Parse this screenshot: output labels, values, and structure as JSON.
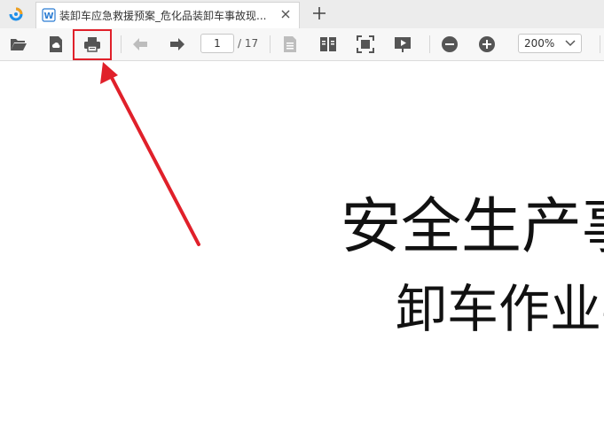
{
  "tab": {
    "title": "装卸车应急救援预案_危化品装卸车事故现...",
    "close_icon": "close-icon",
    "doc_icon": "word-doc-icon"
  },
  "toolbar": {
    "current_page": "1",
    "total_pages": "/ 17",
    "zoom_value": "200%",
    "icons": [
      "folder-open-icon",
      "cloud-save-icon",
      "print-icon",
      "prev-page-icon",
      "next-page-icon",
      "single-page-icon",
      "two-page-icon",
      "fit-screen-icon",
      "slideshow-icon",
      "zoom-out-icon",
      "zoom-in-icon"
    ]
  },
  "document": {
    "title_line1": "安全生产事",
    "title_line2": "卸车作业事"
  },
  "annotation": {
    "highlight_color": "#e0202a",
    "highlight_target": "print-icon"
  }
}
